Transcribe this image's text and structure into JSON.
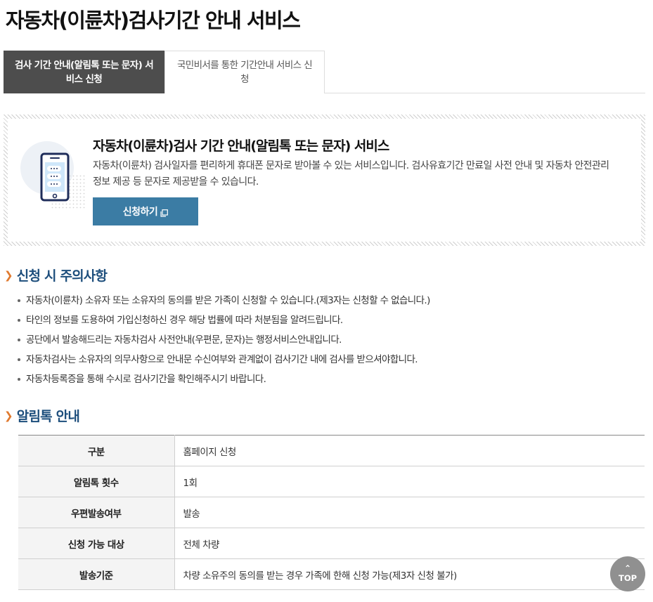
{
  "page_title": "자동차(이륜차)검사기간 안내 서비스",
  "tabs": [
    {
      "label": "검사 기간 안내(알림톡 또는 문자) 서비스 신청",
      "active": true
    },
    {
      "label": "국민비서를 통한 기간안내 서비스 신청",
      "active": false
    }
  ],
  "service": {
    "title": "자동차(이륜차)검사 기간 안내(알림톡 또는 문자) 서비스",
    "description": "자동차(이륜차) 검사일자를 편리하게 휴대폰 문자로 받아볼 수 있는 서비스입니다. 검사유효기간 만료일 사전 안내 및 자동차 안전관리 정보 제공 등 문자로 제공받을 수 있습니다.",
    "apply_label": "신청하기",
    "icon": "phone-message-icon"
  },
  "notice": {
    "title": "신청 시 주의사항",
    "items": [
      "자동차(이륜차) 소유자 또는 소유자의 동의를 받은 가족이 신청할 수 있습니다.(제3자는 신청할 수 없습니다.)",
      "타인의 정보를 도용하여 가입신청하신 경우 해당 법률에 따라 처분됨을 알려드립니다.",
      "공단에서 발송해드리는 자동차검사 사전안내(우편문, 문자)는 행정서비스안내입니다.",
      "자동차검사는 소유자의 의무사항으로 안내문 수신여부와 관계없이 검사기간 내에 검사를 받으셔야합니다.",
      "자동차등록증을 통해 수시로 검사기간을 확인해주시기 바랍니다."
    ]
  },
  "alimtalk": {
    "title": "알림톡 안내",
    "rows": [
      {
        "label": "구분",
        "value": "홈페이지 신청"
      },
      {
        "label": "알림톡 횟수",
        "value": "1회"
      },
      {
        "label": "우편발송여부",
        "value": "발송"
      },
      {
        "label": "신청 가능 대상",
        "value": "전체 차량"
      },
      {
        "label": "발송기준",
        "value": "차량 소유주의 동의를 받는 경우 가족에 한해 신청 가능(제3자 신청 불가)"
      }
    ]
  },
  "top_button": "TOP",
  "colors": {
    "accent": "#3b7ca4",
    "section_title": "#1d4e7c",
    "chevron": "#e07a2f",
    "active_tab": "#4d4d4d"
  }
}
